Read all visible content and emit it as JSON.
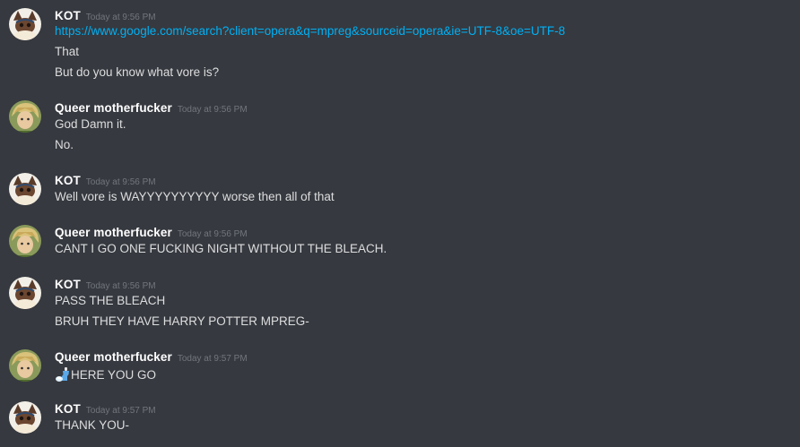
{
  "messages": [
    {
      "author": "KOT",
      "timestamp": "Today at 9:56 PM",
      "lines": [
        "https://www.google.com/search?client=opera&q=mpreg&sourceid=opera&ie=UTF-8&oe=UTF-8",
        "That",
        "But do you know what vore is?"
      ]
    },
    {
      "author": "Queer motherfucker",
      "timestamp": "Today at 9:56 PM",
      "lines": [
        "God Damn it.",
        "No."
      ]
    },
    {
      "author": "KOT",
      "timestamp": "Today at 9:56 PM",
      "lines": [
        "Well vore is WAYYYYYYYYYY worse then all of that"
      ]
    },
    {
      "author": "Queer motherfucker",
      "timestamp": "Today at 9:56 PM",
      "lines": [
        "CANT I GO ONE FUCKING NIGHT WITHOUT THE BLEACH."
      ]
    },
    {
      "author": "KOT",
      "timestamp": "Today at 9:56 PM",
      "lines": [
        "PASS THE BLEACH",
        "BRUH THEY HAVE HARRY POTTER MPREG-"
      ]
    },
    {
      "author": "Queer motherfucker",
      "timestamp": "Today at 9:57 PM",
      "lines": [
        "HERE YOU GO"
      ],
      "emoji": "bottle-emoji"
    },
    {
      "author": "KOT",
      "timestamp": "Today at 9:57 PM",
      "lines": [
        "THANK YOU-"
      ]
    }
  ],
  "colors": {
    "background": "#36393f",
    "username": "#ffffff",
    "timestamp": "#72767d",
    "text": "#dcddde",
    "link": "#00b0f4"
  }
}
